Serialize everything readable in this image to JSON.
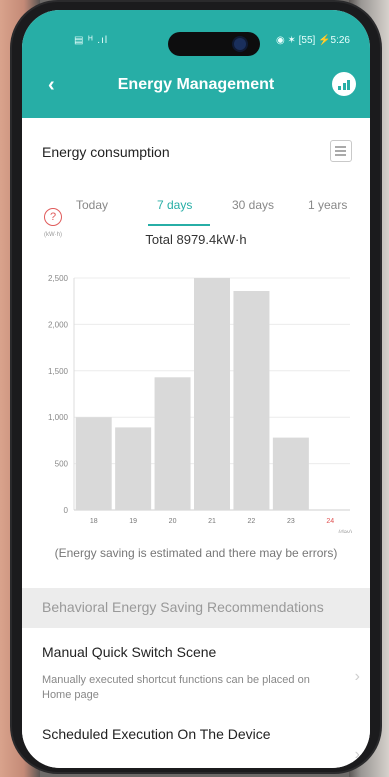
{
  "status_bar": {
    "left": "▤ ᴴ .ıl",
    "right": "◉ ✶ [55] ⚡5:26"
  },
  "header": {
    "title": "Energy Management"
  },
  "card": {
    "title": "Energy consumption",
    "tabs": [
      {
        "label": "Today",
        "active": false
      },
      {
        "label": "7 days",
        "active": true
      },
      {
        "label": "30 days",
        "active": false
      },
      {
        "label": "1 years",
        "active": false
      }
    ],
    "unit_label": "(kW·h)",
    "total_label": "Total 8979.4kW·h",
    "note": "(Energy saving is estimated and there may be errors)"
  },
  "chart_data": {
    "type": "bar",
    "categories": [
      "18",
      "19",
      "20",
      "21",
      "22",
      "23",
      "24"
    ],
    "values": [
      1000,
      890,
      1430,
      2500,
      2360,
      780,
      0
    ],
    "ylim": [
      0,
      2500
    ],
    "yticks": [
      "0",
      "500",
      "1,000",
      "1,500",
      "2,000",
      "2,500"
    ],
    "ylabel": "(kW·h)",
    "xlabel": "(day)",
    "grid": true,
    "colors": {
      "bar": "#d9d9d9",
      "highlight_tick": "#e05050"
    }
  },
  "section": {
    "header": "Behavioral Energy Saving Recommendations"
  },
  "recommendations": [
    {
      "title": "Manual Quick Switch Scene",
      "desc": "Manually executed shortcut functions can be placed on Home page"
    },
    {
      "title": "Scheduled Execution On The Device",
      "desc": ""
    }
  ],
  "icons": {
    "back": "back-chevron-icon",
    "signal": "signal-bars-icon",
    "list": "list-icon",
    "help": "question-icon"
  }
}
